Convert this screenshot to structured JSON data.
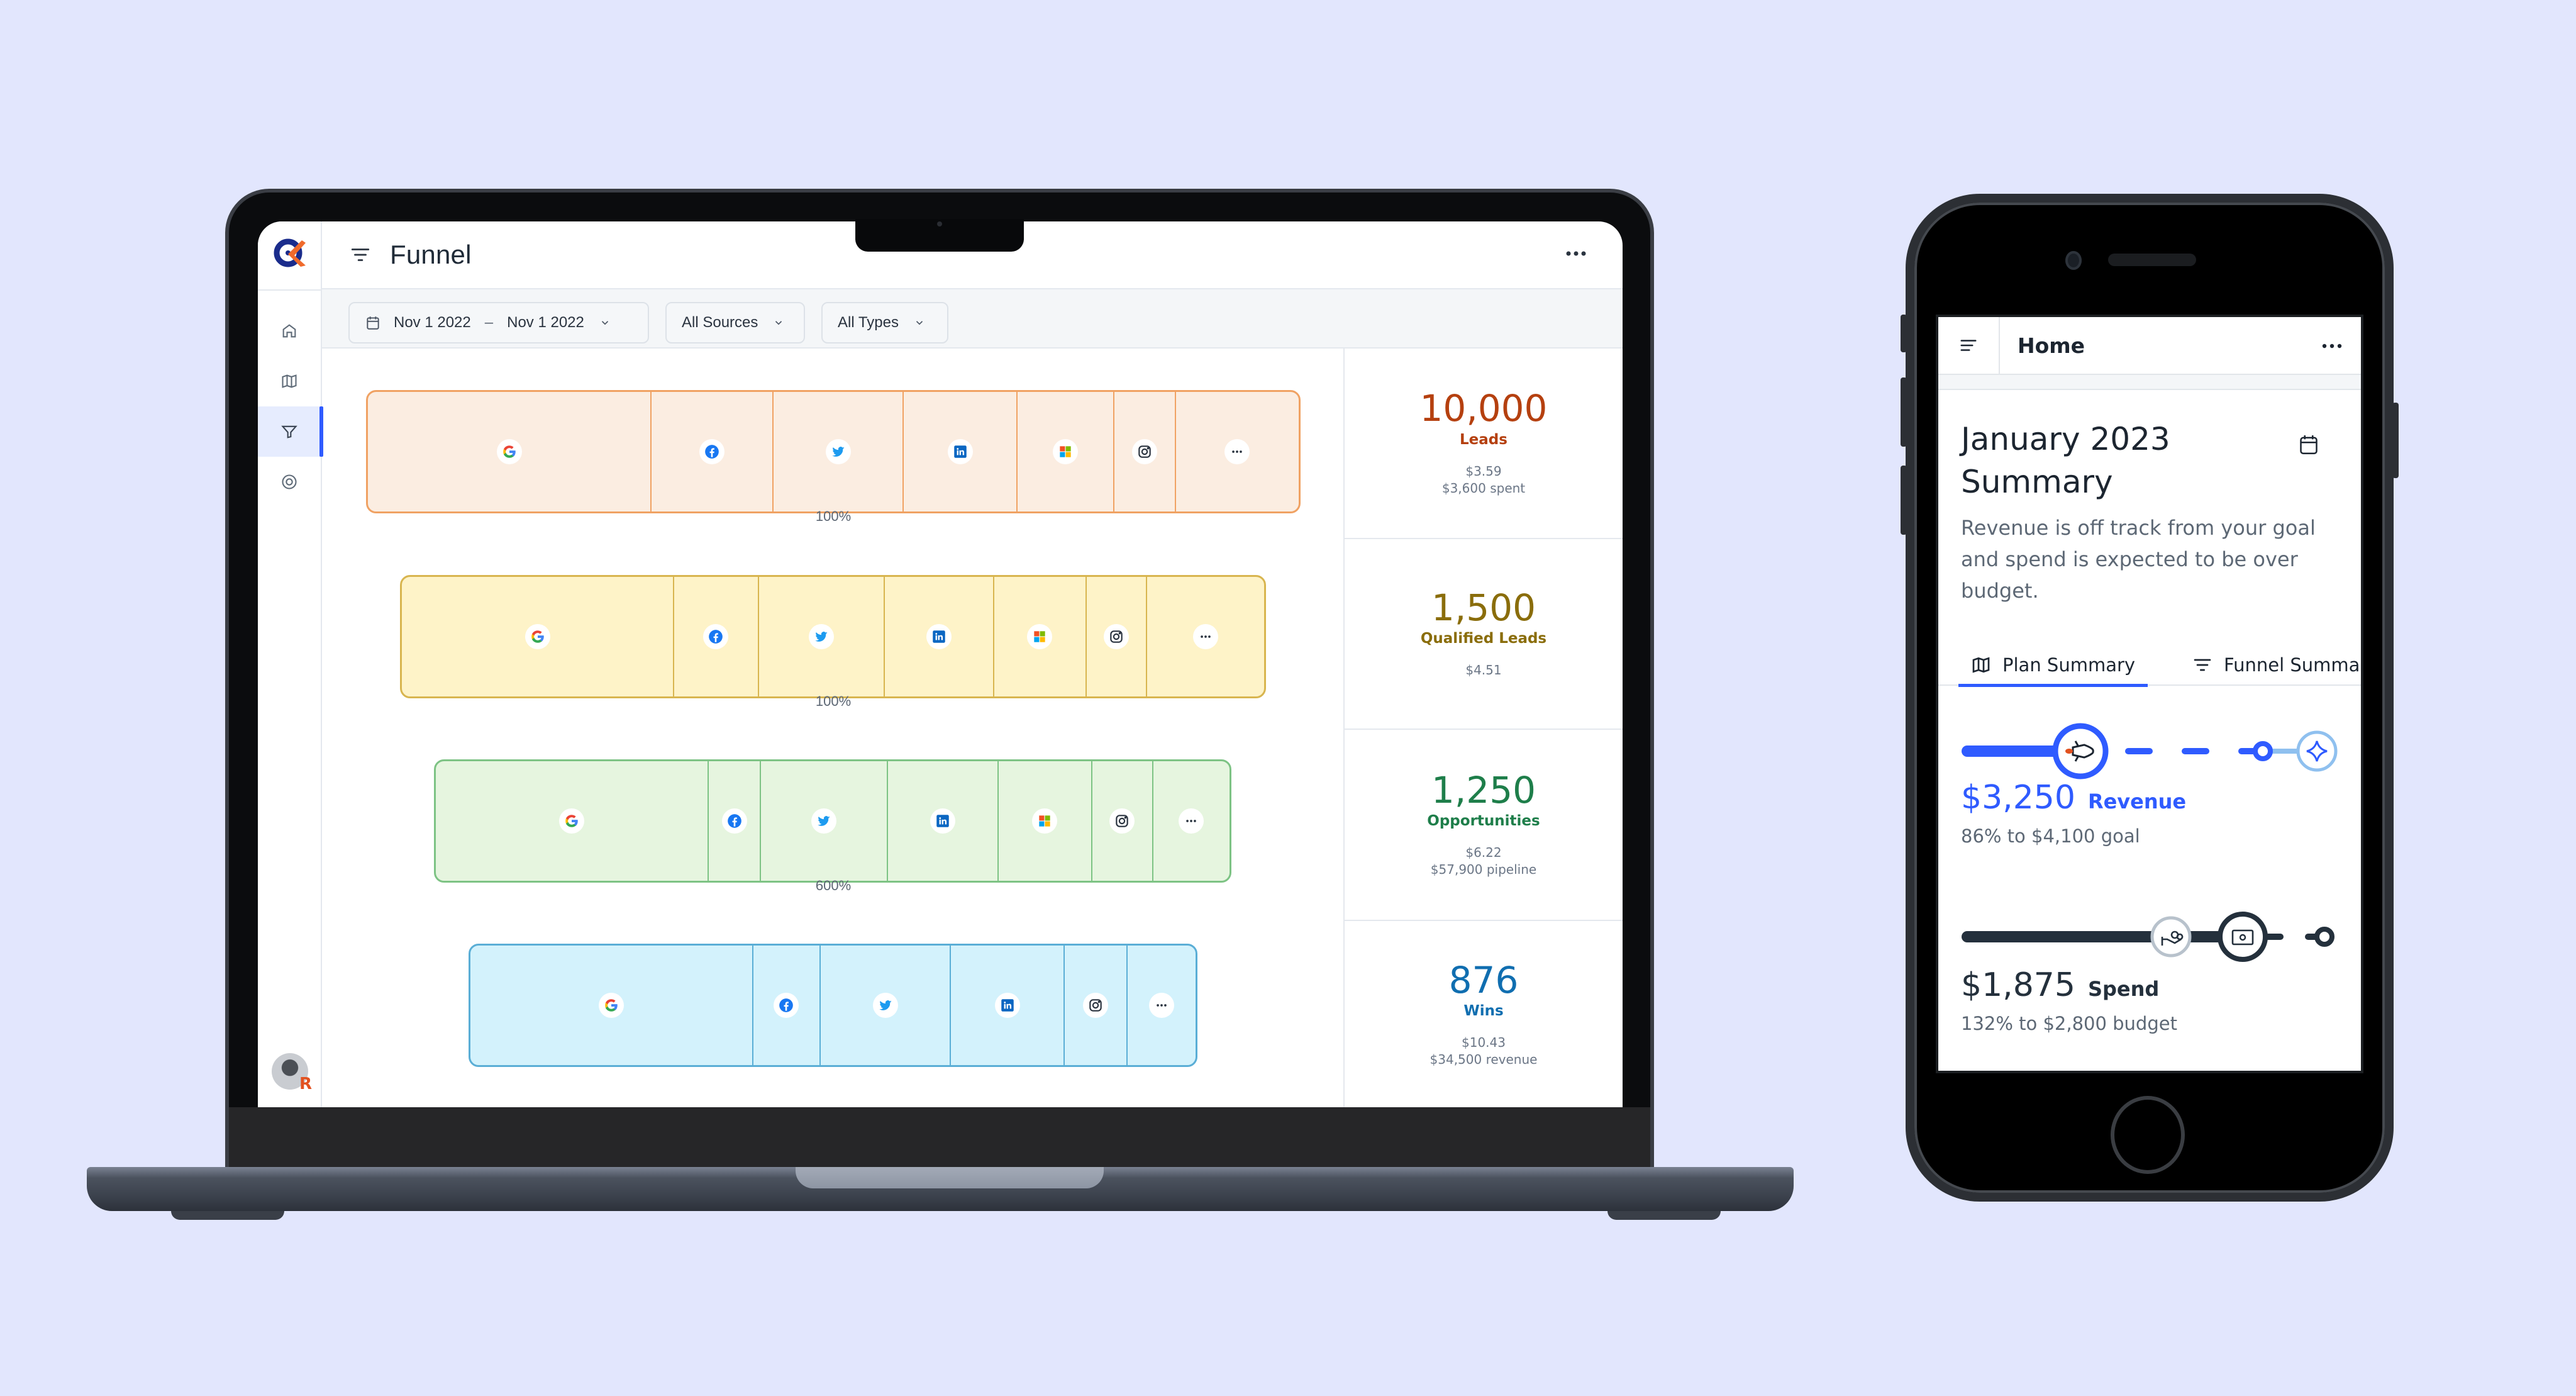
{
  "colors": {
    "background": "#e2e6fd",
    "accent": "#2f5bff",
    "leads": "#b5400f",
    "qualified": "#8a6d0b",
    "opportunities": "#1e7e4a",
    "wins": "#106eb0"
  },
  "laptop": {
    "app": {
      "logo": "logo-icon",
      "sidebar": {
        "items": [
          {
            "name": "home",
            "icon": "home-icon",
            "active": false
          },
          {
            "name": "plan",
            "icon": "map-icon",
            "active": false
          },
          {
            "name": "funnel",
            "icon": "funnel-icon",
            "active": true
          },
          {
            "name": "integrations",
            "icon": "disc-icon",
            "active": false
          }
        ],
        "avatar_badge": "R"
      },
      "header": {
        "menu_icon": "filter-lines-icon",
        "title": "Funnel",
        "more_icon": "more-horizontal-icon"
      },
      "filters": {
        "date_start": "Nov 1 2022",
        "date_separator": "–",
        "date_end": "Nov 1 2022",
        "sources": "All Sources",
        "types": "All Types"
      },
      "funnel": {
        "stages": [
          {
            "name": "Leads",
            "fill": "#fbede1",
            "stroke": "#f0a263",
            "sources": [
              {
                "source": "google",
                "share": 0.305
              },
              {
                "source": "facebook",
                "share": 0.131
              },
              {
                "source": "twitter",
                "share": 0.14
              },
              {
                "source": "linkedin",
                "share": 0.122
              },
              {
                "source": "microsoft",
                "share": 0.104
              },
              {
                "source": "instagram",
                "share": 0.066
              },
              {
                "source": "more",
                "share": 0.132
              }
            ],
            "conversion_label": "100%"
          },
          {
            "name": "Qualified Leads",
            "fill": "#fef3c8",
            "stroke": "#d8b54f",
            "sources": [
              {
                "source": "google",
                "share": 0.316
              },
              {
                "source": "facebook",
                "share": 0.098
              },
              {
                "source": "twitter",
                "share": 0.146
              },
              {
                "source": "linkedin",
                "share": 0.127
              },
              {
                "source": "microsoft",
                "share": 0.107
              },
              {
                "source": "instagram",
                "share": 0.07
              },
              {
                "source": "more",
                "share": 0.136
              }
            ],
            "conversion_label": "100%"
          },
          {
            "name": "Opportunities",
            "fill": "#e6f5df",
            "stroke": "#7dc384",
            "sources": [
              {
                "source": "google",
                "share": 0.344
              },
              {
                "source": "facebook",
                "share": 0.066
              },
              {
                "source": "twitter",
                "share": 0.16
              },
              {
                "source": "linkedin",
                "share": 0.139
              },
              {
                "source": "microsoft",
                "share": 0.118
              },
              {
                "source": "instagram",
                "share": 0.077
              },
              {
                "source": "more",
                "share": 0.096
              }
            ],
            "conversion_label": "600%"
          },
          {
            "name": "Wins",
            "fill": "#d3f2fc",
            "stroke": "#5aaed6",
            "sources": [
              {
                "source": "google",
                "share": 0.39
              },
              {
                "source": "facebook",
                "share": 0.093
              },
              {
                "source": "twitter",
                "share": 0.18
              },
              {
                "source": "linkedin",
                "share": 0.157
              },
              {
                "source": "instagram",
                "share": 0.086
              },
              {
                "source": "more",
                "share": 0.094
              }
            ],
            "conversion_label": ""
          }
        ]
      },
      "stats": [
        {
          "value": "10,000",
          "label": "Leads",
          "lines": [
            "$3.59",
            "$3,600 spent"
          ],
          "color": "#b5400f"
        },
        {
          "value": "1,500",
          "label": "Qualified Leads",
          "lines": [
            "$4.51"
          ],
          "color": "#8a6d0b"
        },
        {
          "value": "1,250",
          "label": "Opportunities",
          "lines": [
            "$6.22",
            "$57,900 pipeline"
          ],
          "color": "#1e7e4a"
        },
        {
          "value": "876",
          "label": "Wins",
          "lines": [
            "$10.43",
            "$34,500 revenue"
          ],
          "color": "#106eb0"
        }
      ]
    }
  },
  "phone": {
    "header": {
      "menu_icon": "filter-lines-icon",
      "title": "Home",
      "more_icon": "more-horizontal-icon"
    },
    "summary": {
      "title": "January 2023 Summary",
      "calendar_icon": "calendar-icon",
      "description": "Revenue is off track from your goal and spend is expected to be over budget."
    },
    "tabs": [
      {
        "label": "Plan Summary",
        "icon": "map-icon",
        "active": true
      },
      {
        "label": "Funnel Summary",
        "icon": "filter-lines-icon",
        "active": false
      }
    ],
    "revenue": {
      "amount": "$3,250",
      "label": "Revenue",
      "detail": "86% to $4,100 goal",
      "progress": 0.86,
      "color": "#2f5bff"
    },
    "spend": {
      "amount": "$1,875",
      "label": "Spend",
      "detail": "132% to $2,800 budget",
      "progress": 1.32,
      "color": "#24303c"
    }
  }
}
